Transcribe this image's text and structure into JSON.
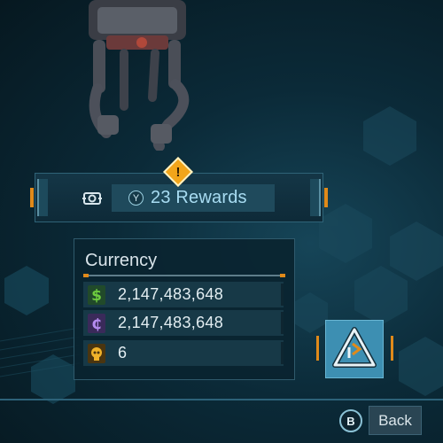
{
  "rewards": {
    "button_hint": "Y",
    "label": "23 Rewards",
    "alert_icon": "warning-diamond-icon",
    "accent": "#f2a51a"
  },
  "currency": {
    "title": "Currency",
    "rows": [
      {
        "icon": "dollar-credits-icon",
        "value": "2,147,483,648",
        "color": "#6ecb3f"
      },
      {
        "icon": "eridium-currency-icon",
        "value": "2,147,483,648",
        "color": "#a57be0"
      },
      {
        "icon": "skull-token-icon",
        "value": "6",
        "color": "#f0b22a"
      }
    ]
  },
  "prestige": {
    "icon": "shift-triangle-icon"
  },
  "footer": {
    "back_hint": "B",
    "back_label": "Back"
  }
}
